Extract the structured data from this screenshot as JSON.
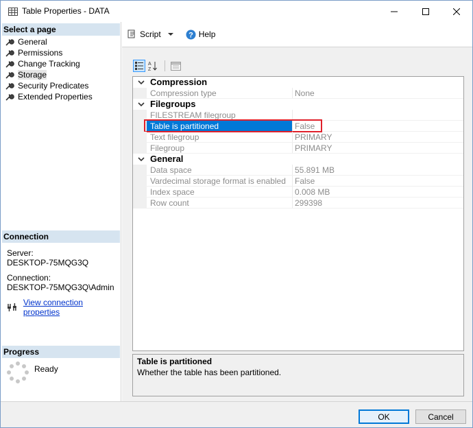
{
  "window": {
    "title": "Table Properties - DATA"
  },
  "left": {
    "select_page_header": "Select a page",
    "pages": [
      {
        "label": "General"
      },
      {
        "label": "Permissions"
      },
      {
        "label": "Change Tracking"
      },
      {
        "label": "Storage",
        "selected": true
      },
      {
        "label": "Security Predicates"
      },
      {
        "label": "Extended Properties"
      }
    ],
    "connection_header": "Connection",
    "server_label": "Server:",
    "server_value": "DESKTOP-75MQG3Q",
    "connection_label": "Connection:",
    "connection_value": "DESKTOP-75MQG3Q\\Admin",
    "view_connection_link": "View connection properties",
    "progress_header": "Progress",
    "progress_status": "Ready"
  },
  "toolbar": {
    "script_label": "Script",
    "help_label": "Help"
  },
  "grid": {
    "categories": [
      {
        "label": "Compression",
        "properties": [
          {
            "name": "Compression type",
            "value": "None"
          }
        ]
      },
      {
        "label": "Filegroups",
        "properties": [
          {
            "name": "FILESTREAM filegroup",
            "value": ""
          },
          {
            "name": "Table is partitioned",
            "value": "False",
            "selected": true
          },
          {
            "name": "Text filegroup",
            "value": "PRIMARY"
          },
          {
            "name": "Filegroup",
            "value": "PRIMARY"
          }
        ]
      },
      {
        "label": "General",
        "properties": [
          {
            "name": "Data space",
            "value": "55.891 MB"
          },
          {
            "name": "Vardecimal storage format is enabled",
            "value": "False"
          },
          {
            "name": "Index space",
            "value": "0.008 MB"
          },
          {
            "name": "Row count",
            "value": "299398"
          }
        ]
      }
    ]
  },
  "description": {
    "title": "Table is partitioned",
    "text": "Whether the table has been partitioned."
  },
  "footer": {
    "ok_label": "OK",
    "cancel_label": "Cancel"
  },
  "colors": {
    "selection": "#0078d7",
    "highlight_box": "#e0202a",
    "section_header": "#d6e4f0",
    "link": "#0033cc"
  }
}
